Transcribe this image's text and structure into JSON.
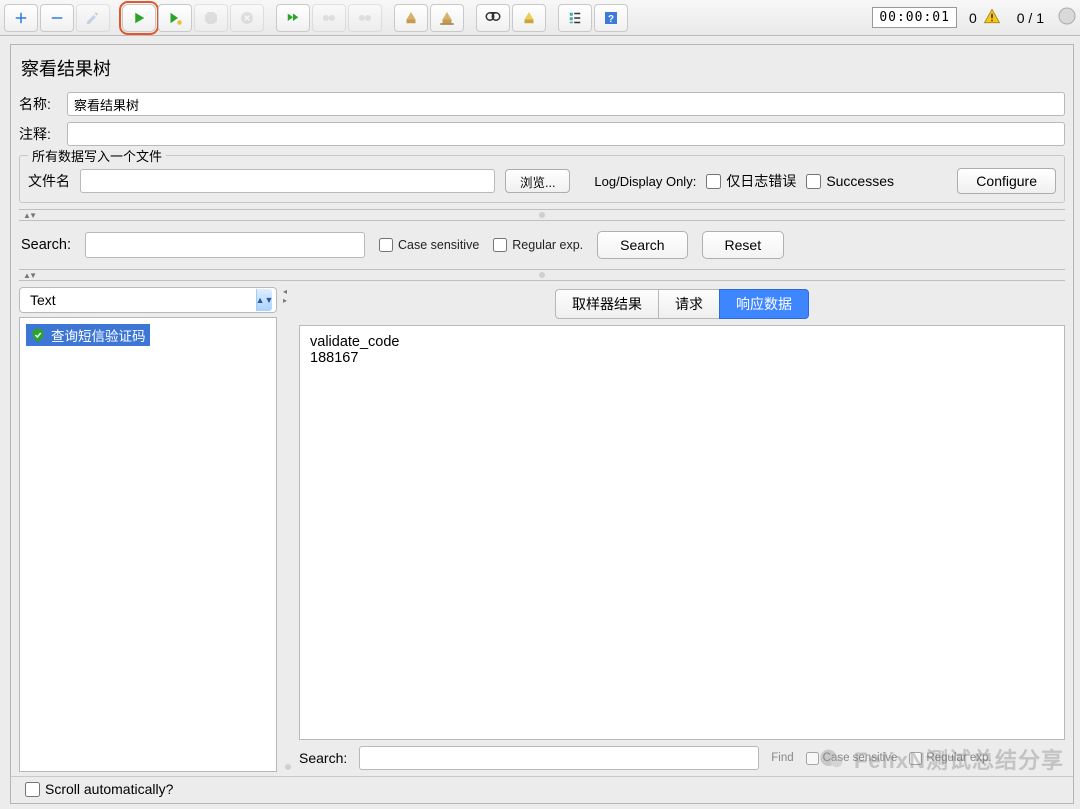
{
  "toolbar": {
    "timer": "00:00:01",
    "warning_count": "0",
    "thread_ratio": "0 / 1"
  },
  "panel": {
    "title": "察看结果树",
    "name_label": "名称:",
    "name_value": "察看结果树",
    "comment_label": "注释:",
    "comment_value": ""
  },
  "file_group": {
    "legend": "所有数据写入一个文件",
    "filename_label": "文件名",
    "filename_value": "",
    "browse_btn": "浏览...",
    "logdisplay_label": "Log/Display Only:",
    "only_errors_label": "仅日志错误",
    "successes_label": "Successes",
    "configure_btn": "Configure"
  },
  "search_bar": {
    "label": "Search:",
    "value": "",
    "case_label": "Case sensitive",
    "regex_label": "Regular exp.",
    "search_btn": "Search",
    "reset_btn": "Reset"
  },
  "left": {
    "dropdown_value": "Text",
    "tree_item": "查询短信验证码"
  },
  "right": {
    "tabs": {
      "sampler": "取样器结果",
      "request": "请求",
      "response": "响应数据",
      "active": "response"
    },
    "response_body": "validate_code\n188167",
    "lower_search_label": "Search:",
    "lower_find_btn": "Find",
    "lower_case_label": "Case sensitive",
    "lower_regex_label": "Regular exp."
  },
  "bottom": {
    "scroll_label": "Scroll automatically?"
  },
  "watermark": "FelixN测试总结分享"
}
